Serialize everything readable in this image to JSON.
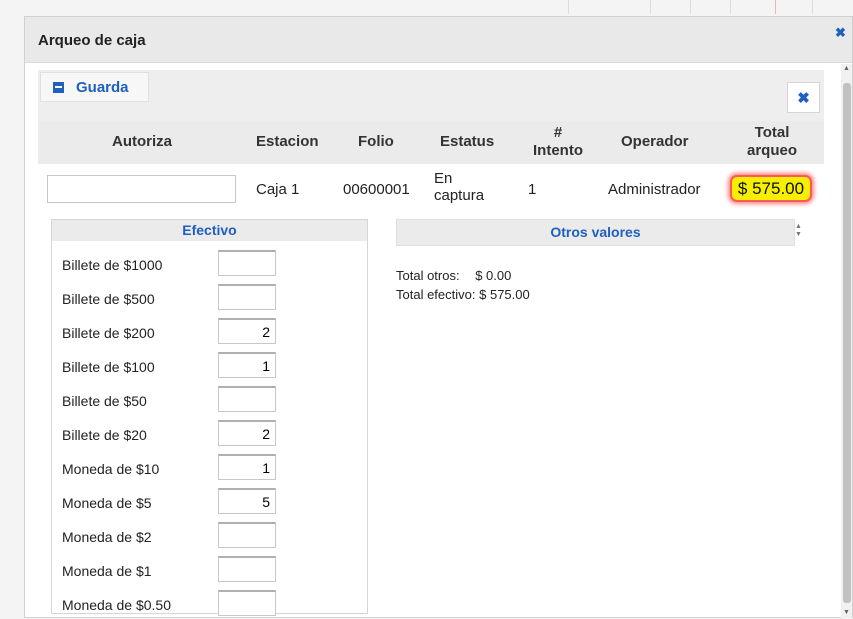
{
  "dialog": {
    "title": "Arqueo de caja",
    "outer_close_glyph": "✖"
  },
  "toolbar": {
    "save_label": "Guarda",
    "save_icon": "archive-icon",
    "close_glyph": "✖"
  },
  "table": {
    "headers": {
      "autoriza": "Autoriza",
      "estacion": "Estacion",
      "folio": "Folio",
      "estatus": "Estatus",
      "intento_1": "#",
      "intento_2": "Intento",
      "operador": "Operador",
      "total_1": "Total",
      "total_2": "arqueo"
    },
    "row": {
      "autoriza_value": "",
      "estacion": "Caja 1",
      "folio": "00600001",
      "estatus_1": "En",
      "estatus_2": "captura",
      "intento": "1",
      "operador": "Administrador",
      "total_arqueo": "$ 575.00"
    }
  },
  "efectivo": {
    "title": "Efectivo",
    "rows": [
      {
        "label": "Billete de $1000",
        "value": ""
      },
      {
        "label": "Billete de $500",
        "value": ""
      },
      {
        "label": "Billete de $200",
        "value": "2"
      },
      {
        "label": "Billete de $100",
        "value": "1"
      },
      {
        "label": "Billete de $50",
        "value": ""
      },
      {
        "label": "Billete de $20",
        "value": "2"
      },
      {
        "label": "Moneda de $10",
        "value": "1"
      },
      {
        "label": "Moneda de $5",
        "value": "5"
      },
      {
        "label": "Moneda de $2",
        "value": ""
      },
      {
        "label": "Moneda de $1",
        "value": ""
      },
      {
        "label": "Moneda de $0.50",
        "value": ""
      }
    ]
  },
  "otros": {
    "title": "Otros valores",
    "total_otros_label": "Total otros:",
    "total_otros_value": "$ 0.00",
    "total_efectivo_label": "Total efectivo:",
    "total_efectivo_value": "$ 575.00"
  },
  "colors": {
    "accent": "#1f5fbf",
    "highlight": "#f6f000",
    "highlight_border": "#ff5858"
  }
}
